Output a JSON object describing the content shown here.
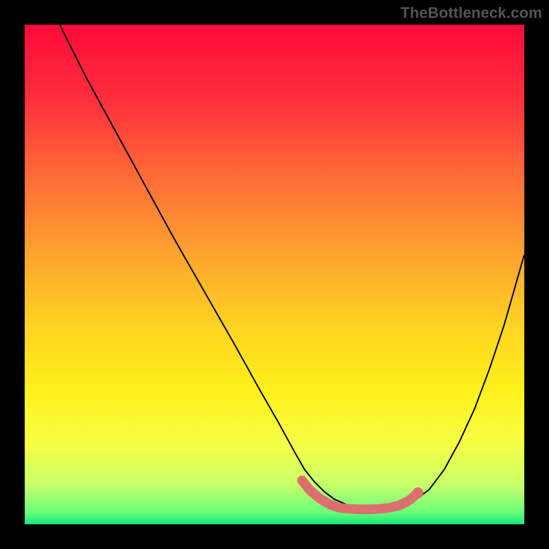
{
  "watermark": "TheBottleneck.com",
  "chart_data": {
    "type": "line",
    "title": "",
    "subtitle": "",
    "xlabel": "",
    "ylabel": "",
    "xlim": [
      0,
      100
    ],
    "ylim": [
      0,
      100
    ],
    "grid": false,
    "legend": false,
    "annotations": [],
    "gradient_background": {
      "stops": [
        {
          "pos": 0.0,
          "color": "#ff0a3a"
        },
        {
          "pos": 0.15,
          "color": "#ff2f3d"
        },
        {
          "pos": 0.3,
          "color": "#ff6a38"
        },
        {
          "pos": 0.45,
          "color": "#ffa030"
        },
        {
          "pos": 0.6,
          "color": "#ffd223"
        },
        {
          "pos": 0.73,
          "color": "#fff01a"
        },
        {
          "pos": 0.84,
          "color": "#f6ff46"
        },
        {
          "pos": 0.92,
          "color": "#c8ff6a"
        },
        {
          "pos": 0.975,
          "color": "#6dff7a"
        },
        {
          "pos": 1.0,
          "color": "#17e67a"
        }
      ]
    },
    "series": [
      {
        "name": "curve",
        "color": "#000000",
        "x": [
          7.0,
          12,
          18,
          24,
          30,
          36,
          42,
          47,
          51,
          54,
          56,
          58,
          60,
          62,
          65,
          68,
          70,
          72,
          74,
          76,
          78,
          81,
          84,
          87,
          90,
          93,
          96,
          100
        ],
        "values": [
          100,
          90,
          79,
          68,
          57,
          46.5,
          36,
          27,
          20,
          14.5,
          11,
          8.5,
          6.5,
          5,
          3.7,
          3.0,
          3.0,
          3.0,
          3.2,
          3.7,
          4.7,
          7,
          11,
          16.5,
          23,
          31,
          40,
          54
        ]
      },
      {
        "name": "plateau-marker",
        "color": "#dc6e6f",
        "style": "thick-capped",
        "x": [
          55.5,
          57,
          59,
          61,
          63,
          65,
          67,
          69,
          71,
          73,
          75,
          77,
          78.7
        ],
        "values": [
          8.8,
          6.9,
          5.2,
          4.0,
          3.3,
          3.1,
          3.0,
          3.0,
          3.1,
          3.3,
          3.8,
          4.8,
          6.3
        ],
        "end_dots_y": [
          6.3
        ]
      }
    ]
  }
}
